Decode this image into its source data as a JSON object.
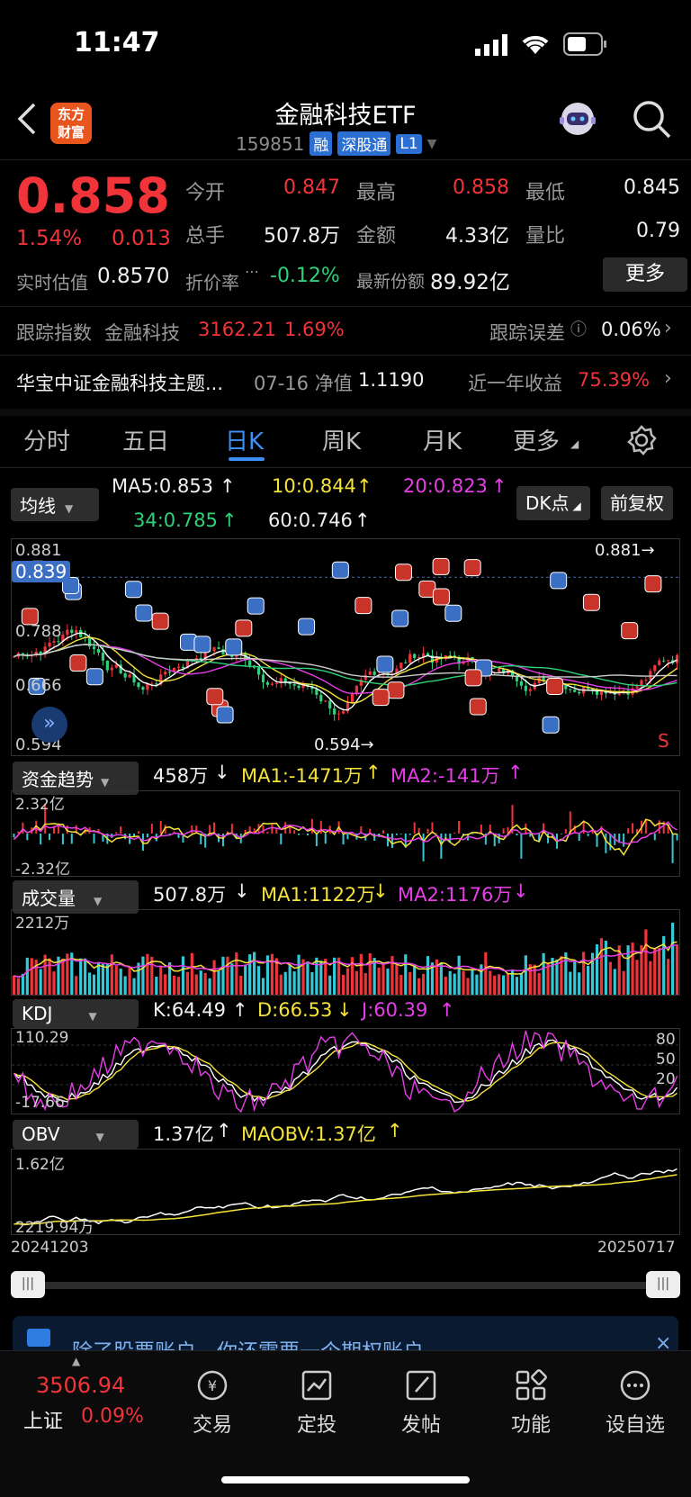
{
  "status": {
    "time": "11:47"
  },
  "header": {
    "logo_line1": "东方",
    "logo_line2": "财富",
    "title": "金融科技ETF",
    "code": "159851",
    "tag1": "融",
    "tag2": "深股通",
    "tag3": "L1"
  },
  "quote": {
    "price": "0.858",
    "change_pct": "1.54%",
    "change": "0.013",
    "open_label": "今开",
    "open": "0.847",
    "high_label": "最高",
    "high": "0.858",
    "low_label": "最低",
    "low": "0.845",
    "hand_label": "总手",
    "hand": "507.8万",
    "amount_label": "金额",
    "amount": "4.33亿",
    "ratio_label": "量比",
    "ratio": "0.79",
    "est_label": "实时估值",
    "est": "0.8570",
    "premium_label": "折价率",
    "premium": "-0.12%",
    "shares_label": "最新份额",
    "shares": "89.92亿",
    "more": "更多"
  },
  "tracking": {
    "label": "跟踪指数",
    "index": "金融科技",
    "value": "3162.21",
    "pct": "1.69%",
    "err_label": "跟踪误差",
    "err": "0.06%"
  },
  "fund": {
    "name": "华宝中证金融科技主题...",
    "date_nav": "07-16 净值",
    "nav": "1.1190",
    "ret_label": "近一年收益",
    "ret": "75.39%"
  },
  "tabs": [
    "分时",
    "五日",
    "日K",
    "周K",
    "月K",
    "更多"
  ],
  "ma": {
    "selector": "均线",
    "ma5": "MA5:0.853",
    "ma10": "10:0.844",
    "ma20": "20:0.823",
    "ma34": "34:0.785",
    "ma60": "60:0.746",
    "dk": "DK点",
    "fq": "前复权"
  },
  "kchart": {
    "y_top": "0.881",
    "y_cur": "0.839",
    "y_mid1": "0.788",
    "y_mid2": "0.666",
    "y_bot": "0.594",
    "hi_mark": "0.881→",
    "lo_mark": "0.594→",
    "corner": "S"
  },
  "fund_flow": {
    "selector": "资金趋势",
    "v": "458万",
    "ma1": "MA1:-1471万",
    "ma2": "MA2:-141万",
    "top": "2.32亿",
    "bot": "-2.32亿"
  },
  "volume": {
    "selector": "成交量",
    "v": "507.8万",
    "ma1": "MA1:1122万",
    "ma2": "MA2:1176万",
    "top": "2212万"
  },
  "kdj": {
    "selector": "KDJ",
    "k": "K:64.49",
    "d": "D:66.53",
    "j": "J:60.39",
    "top": "110.29",
    "bot": "-17.66",
    "l80": "80",
    "l50": "50",
    "l20": "20"
  },
  "obv": {
    "selector": "OBV",
    "v": "1.37亿",
    "ma": "MAOBV:1.37亿",
    "top": "1.62亿",
    "bot": "2219.94万",
    "date_start": "20241203",
    "date_end": "20250717"
  },
  "banner": {
    "text": "除了股票账户，你还需要一个期权账户"
  },
  "bottom": {
    "index_value": "3506.94",
    "index_name": "上证",
    "index_pct": "0.09%",
    "nav": [
      "交易",
      "定投",
      "发帖",
      "功能",
      "设自选"
    ]
  },
  "colors": {
    "up": "#f0343a",
    "down": "#2fd27a",
    "accent": "#3d8ef5"
  }
}
